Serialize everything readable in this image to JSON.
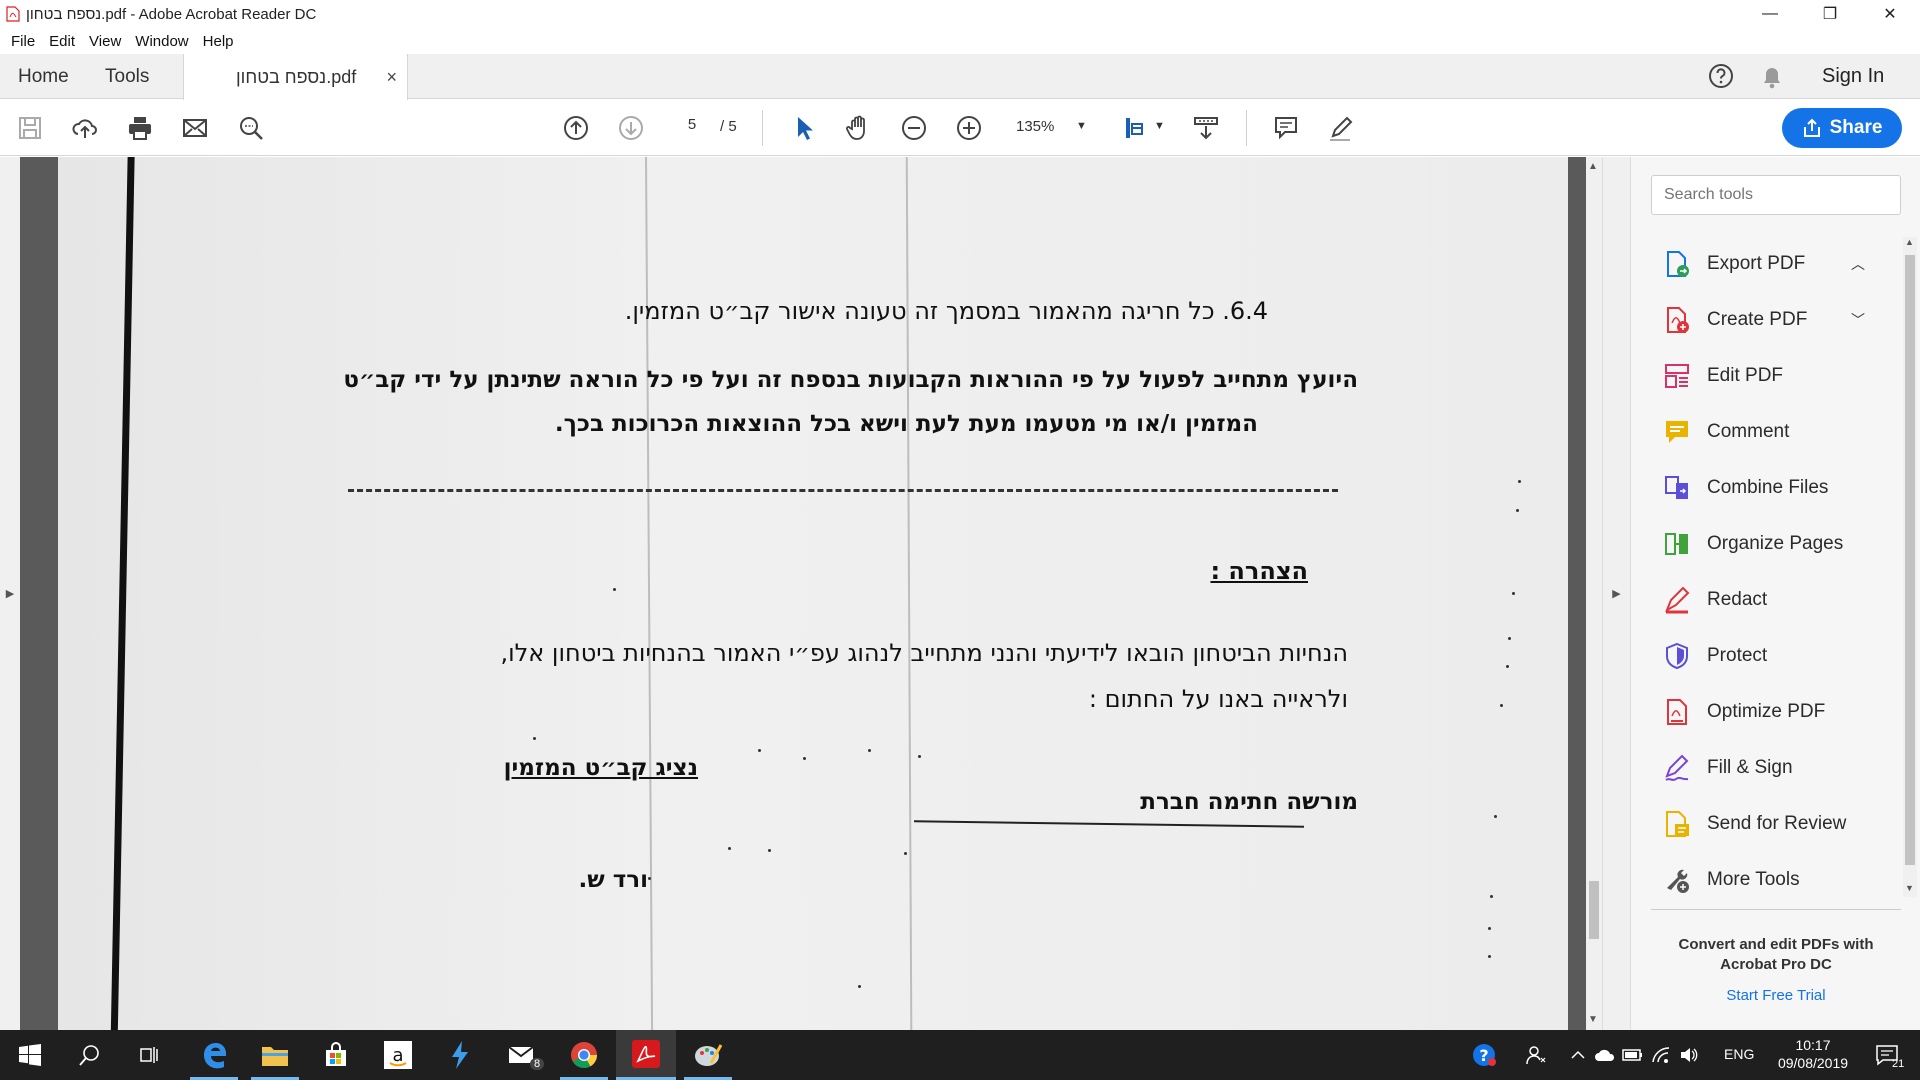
{
  "window": {
    "title": "נספח בטחון.pdf - Adobe Acrobat Reader DC",
    "minimize": "—",
    "maximize": "❐",
    "close": "✕"
  },
  "menu": [
    "File",
    "Edit",
    "View",
    "Window",
    "Help"
  ],
  "tabs": {
    "home": "Home",
    "tools": "Tools",
    "document": "נספח בטחון.pdf",
    "close": "×",
    "signin": "Sign In"
  },
  "toolbar": {
    "page_current": "5",
    "page_total": "/ 5",
    "zoom": "135%",
    "share": "Share"
  },
  "document": {
    "line_6_4": "6.4. כל חריגה מהאמור במסמך זה טעונה אישור קב״ט המזמין.",
    "para_line1": "היועץ מתחייב לפעול על פי ההוראות הקבועות בנספח זה ועל פי כל הוראה שתינתן על ידי קב״ט",
    "para_line2": "המזמין ו/או מי מטעמו מעת לעת וישא בכל ההוצאות הכרוכות בכך.",
    "declaration_title": "הצהרה :",
    "decl_line1": "הנחיות הביטחון הובאו לידיעתי והנני מתחייב לנהוג עפ״י האמור בהנחיות ביטחון אלו,",
    "decl_line2": "ולראייה באנו  על החתום :",
    "sign_left": "נציג קב״ט המזמין",
    "sign_right": "מורשה חתימה  חברת",
    "signature": "ורד ש."
  },
  "tools_pane": {
    "search_placeholder": "Search tools",
    "items": [
      {
        "label": "Export PDF",
        "icon": "export-pdf-icon",
        "color": "#2c9e5a"
      },
      {
        "label": "Create PDF",
        "icon": "create-pdf-icon",
        "color": "#e0343c"
      },
      {
        "label": "Edit PDF",
        "icon": "edit-pdf-icon",
        "color": "#d8326a"
      },
      {
        "label": "Comment",
        "icon": "comment-icon",
        "color": "#e8b400"
      },
      {
        "label": "Combine Files",
        "icon": "combine-files-icon",
        "color": "#5a4fd6"
      },
      {
        "label": "Organize Pages",
        "icon": "organize-pages-icon",
        "color": "#3da33a"
      },
      {
        "label": "Redact",
        "icon": "redact-icon",
        "color": "#e0343c"
      },
      {
        "label": "Protect",
        "icon": "protect-icon",
        "color": "#5a4fd6"
      },
      {
        "label": "Optimize PDF",
        "icon": "optimize-pdf-icon",
        "color": "#e0343c"
      },
      {
        "label": "Fill & Sign",
        "icon": "fill-sign-icon",
        "color": "#7a44d6"
      },
      {
        "label": "Send for Review",
        "icon": "send-review-icon",
        "color": "#e8b400"
      },
      {
        "label": "More Tools",
        "icon": "more-tools-icon",
        "color": "#555555"
      }
    ],
    "promo": "Convert and edit PDFs with Acrobat Pro DC",
    "trial": "Start Free Trial"
  },
  "taskbar": {
    "mail_badge": "8",
    "language": "ENG",
    "time": "10:17",
    "date": "09/08/2019",
    "notifications": "21"
  },
  "colors": {
    "accent": "#1473e6",
    "taskbar": "#1f1f1f"
  }
}
